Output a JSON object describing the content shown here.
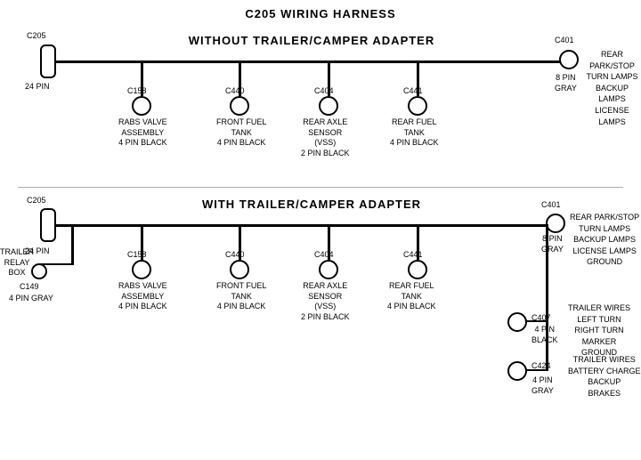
{
  "title": "C205 WIRING HARNESS",
  "section1": {
    "label": "WITHOUT TRAILER/CAMPER ADAPTER",
    "left_connector": {
      "id": "C205",
      "pin": "24 PIN"
    },
    "right_connector": {
      "id": "C401",
      "pin": "8 PIN",
      "color": "GRAY",
      "desc": "REAR PARK/STOP\nTURN LAMPS\nBACKUP LAMPS\nLICENSE LAMPS"
    },
    "connectors": [
      {
        "id": "C158",
        "desc": "RABS VALVE\nASSEMBLY\n4 PIN BLACK"
      },
      {
        "id": "C440",
        "desc": "FRONT FUEL\nTANK\n4 PIN BLACK"
      },
      {
        "id": "C404",
        "desc": "REAR AXLE\nSENSOR\n(VSS)\n2 PIN BLACK"
      },
      {
        "id": "C441",
        "desc": "REAR FUEL\nTANK\n4 PIN BLACK"
      }
    ]
  },
  "section2": {
    "label": "WITH TRAILER/CAMPER ADAPTER",
    "left_connector": {
      "id": "C205",
      "pin": "24 PIN"
    },
    "right_connector": {
      "id": "C401",
      "pin": "8 PIN",
      "color": "GRAY",
      "desc": "REAR PARK/STOP\nTURN LAMPS\nBACKUP LAMPS\nLICENSE LAMPS\nGROUND"
    },
    "extra_left": {
      "label": "TRAILER\nRELAY\nBOX",
      "id": "C149",
      "pin": "4 PIN GRAY"
    },
    "connectors": [
      {
        "id": "C158",
        "desc": "RABS VALVE\nASSEMBLY\n4 PIN BLACK"
      },
      {
        "id": "C440",
        "desc": "FRONT FUEL\nTANK\n4 PIN BLACK"
      },
      {
        "id": "C404",
        "desc": "REAR AXLE\nSENSOR\n(VSS)\n2 PIN BLACK"
      },
      {
        "id": "C441",
        "desc": "REAR FUEL\nTANK\n4 PIN BLACK"
      }
    ],
    "right_connectors": [
      {
        "id": "C407",
        "pin": "4 PIN\nBLACK",
        "desc": "TRAILER WIRES\nLEFT TURN\nRIGHT TURN\nMARKER\nGROUND"
      },
      {
        "id": "C424",
        "pin": "4 PIN\nGRAY",
        "desc": "TRAILER WIRES\nBATTERY CHARGE\nBACKUP\nBRAKES"
      }
    ]
  }
}
